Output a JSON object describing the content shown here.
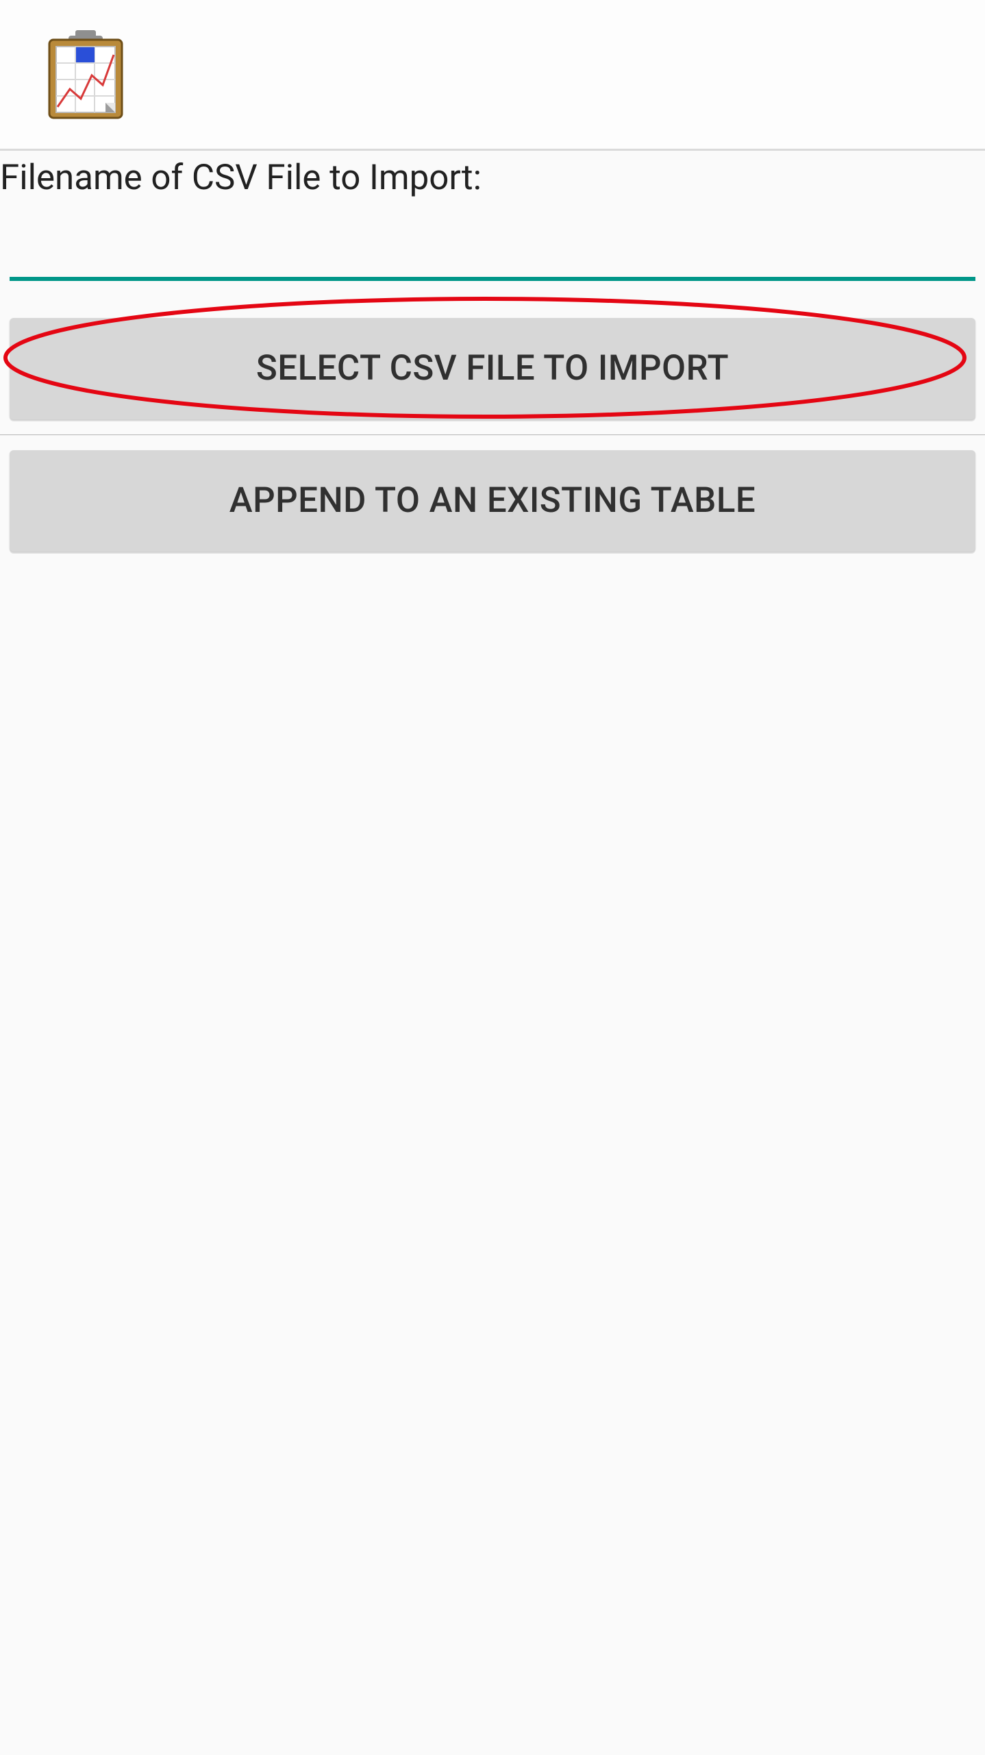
{
  "header": {
    "app_icon_name": "clipboard-chart-icon"
  },
  "form": {
    "filename_label": "Filename of CSV File to Import:",
    "filename_value": ""
  },
  "buttons": {
    "select_csv": "SELECT CSV FILE TO IMPORT",
    "append_table": "APPEND TO AN EXISTING TABLE"
  }
}
